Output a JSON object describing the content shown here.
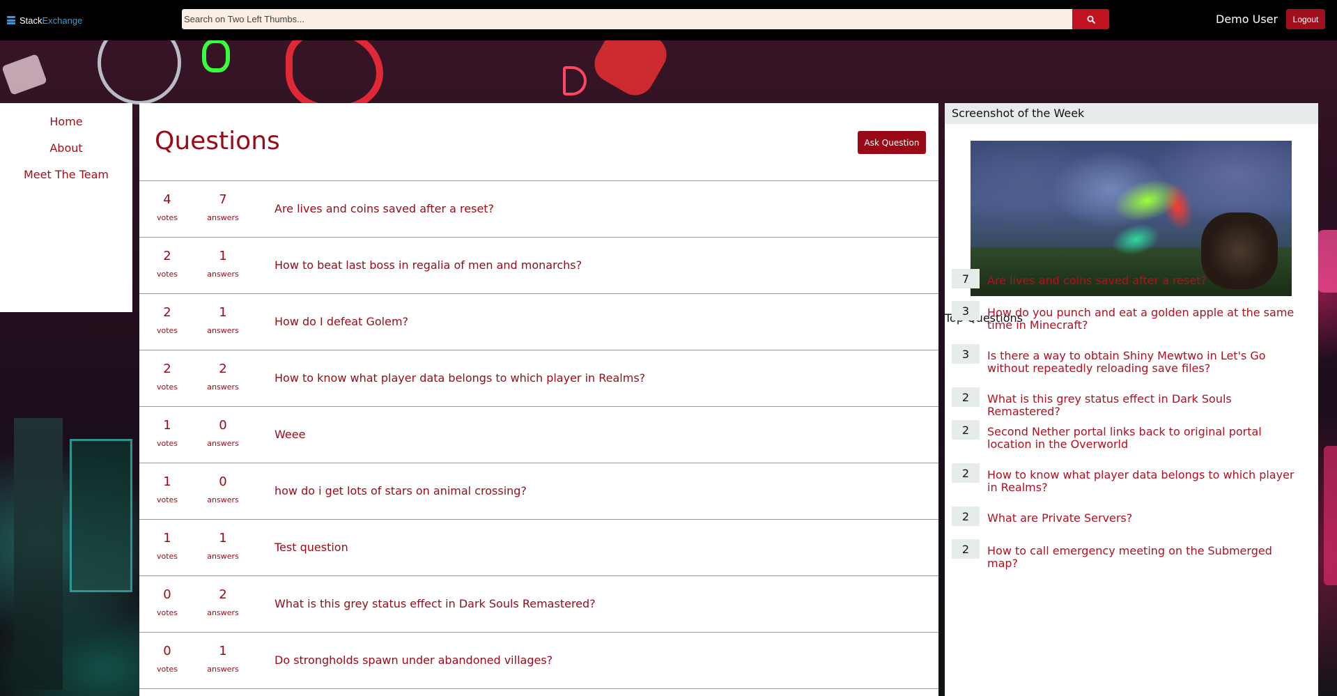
{
  "brand": {
    "part1": "Stack",
    "part2": "Exchange"
  },
  "search": {
    "placeholder": "Search on Two Left Thumbs..."
  },
  "user": {
    "name": "Demo User",
    "logout_label": "Logout"
  },
  "nav": {
    "items": [
      {
        "label": "Home"
      },
      {
        "label": "About"
      },
      {
        "label": "Meet The Team"
      }
    ]
  },
  "main": {
    "title": "Questions",
    "ask_label": "Ask Question",
    "votes_label": "votes",
    "answers_label": "answers",
    "questions": [
      {
        "votes": "4",
        "answers": "7",
        "title": "Are lives and coins saved after a reset?"
      },
      {
        "votes": "2",
        "answers": "1",
        "title": "How to beat last boss in regalia of men and monarchs?"
      },
      {
        "votes": "2",
        "answers": "1",
        "title": "How do I defeat Golem?"
      },
      {
        "votes": "2",
        "answers": "2",
        "title": "How to know what player data belongs to which player in Realms?"
      },
      {
        "votes": "1",
        "answers": "0",
        "title": "Weee"
      },
      {
        "votes": "1",
        "answers": "0",
        "title": "how do i get lots of stars on animal crossing?"
      },
      {
        "votes": "1",
        "answers": "1",
        "title": "Test question"
      },
      {
        "votes": "0",
        "answers": "2",
        "title": "What is this grey status effect in Dark Souls Remastered?"
      },
      {
        "votes": "0",
        "answers": "1",
        "title": "Do strongholds spawn under abandoned villages?"
      }
    ]
  },
  "sidebar": {
    "screenshot_title": "Screenshot of the Week",
    "top_title": "Top Questions",
    "top_questions": [
      {
        "score": "7",
        "title": "Are lives and coins saved after a reset?"
      },
      {
        "score": "3",
        "title": "How do you punch and eat a golden apple at the same time in Minecraft?"
      },
      {
        "score": "3",
        "title": "Is there a way to obtain Shiny Mewtwo in Let's Go without repeatedly reloading save files?"
      },
      {
        "score": "2",
        "title": "What is this grey status effect in Dark Souls Remastered?"
      },
      {
        "score": "2",
        "title": "Second Nether portal links back to original portal location in the Overworld"
      },
      {
        "score": "2",
        "title": "How to know what player data belongs to which player in Realms?"
      },
      {
        "score": "2",
        "title": "What are Private Servers?"
      },
      {
        "score": "2",
        "title": "How to call emergency meeting on the Submerged map?"
      }
    ]
  },
  "colors": {
    "accent": "#9a0a16",
    "button": "#c1121f",
    "brand_blue": "#3d9bd9"
  }
}
